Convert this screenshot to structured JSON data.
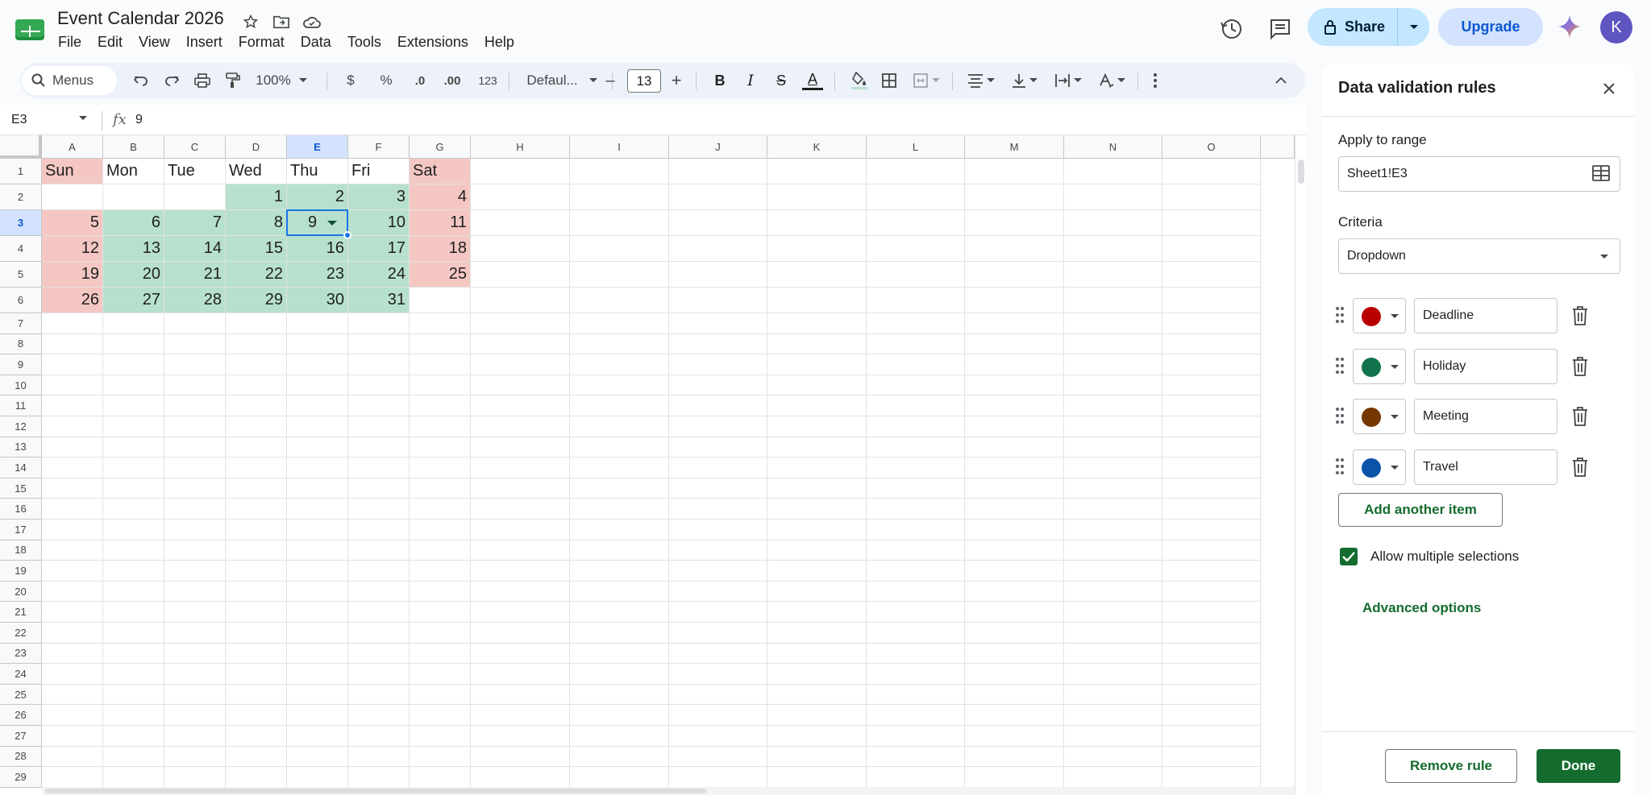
{
  "app": {
    "title": "Event Calendar 2026",
    "menu": [
      "File",
      "Edit",
      "View",
      "Insert",
      "Format",
      "Data",
      "Tools",
      "Extensions",
      "Help"
    ],
    "share_label": "Share",
    "upgrade_label": "Upgrade",
    "avatar_letter": "K"
  },
  "toolbar": {
    "menus_label": "Menus",
    "zoom": "100%",
    "currency": "$",
    "percent": "%",
    "dec_decrease": ".0",
    "dec_increase": ".00",
    "number_format": "123",
    "font": "Defaul...",
    "font_size": "13",
    "minus": "–",
    "plus": "+",
    "bold": "B",
    "italic": "I",
    "strike": "S",
    "text_color": "A"
  },
  "formula_bar": {
    "name_box": "E3",
    "fx": "fx",
    "value": "9"
  },
  "sheet": {
    "columns": [
      "A",
      "B",
      "C",
      "D",
      "E",
      "F",
      "G",
      "H",
      "I",
      "J",
      "K",
      "L",
      "M",
      "N",
      "O"
    ],
    "selected_column": "E",
    "selected_row": 3,
    "row_count": 29,
    "header_row": [
      "Sun",
      "Mon",
      "Tue",
      "Wed",
      "Thu",
      "Fri",
      "Sat"
    ],
    "weeks": [
      [
        "",
        "",
        "",
        "1",
        "2",
        "3",
        "4"
      ],
      [
        "5",
        "6",
        "7",
        "8",
        "9",
        "10",
        "11"
      ],
      [
        "12",
        "13",
        "14",
        "15",
        "16",
        "17",
        "18"
      ],
      [
        "19",
        "20",
        "21",
        "22",
        "23",
        "24",
        "25"
      ],
      [
        "26",
        "27",
        "28",
        "29",
        "30",
        "31",
        ""
      ]
    ],
    "colors": {
      "weekend": "#f4c7c3",
      "weekday": "#b7e1cd",
      "selection": "#1a73e8"
    }
  },
  "panel": {
    "title": "Data validation rules",
    "apply_label": "Apply to range",
    "range_value": "Sheet1!E3",
    "criteria_label": "Criteria",
    "criteria_value": "Dropdown",
    "items": [
      {
        "label": "Deadline",
        "color": "#b80000"
      },
      {
        "label": "Holiday",
        "color": "#11734b"
      },
      {
        "label": "Meeting",
        "color": "#753800"
      },
      {
        "label": "Travel",
        "color": "#0a53a8"
      }
    ],
    "add_item_label": "Add another item",
    "allow_multiple_label": "Allow multiple selections",
    "allow_multiple_checked": true,
    "advanced_label": "Advanced options",
    "remove_label": "Remove rule",
    "done_label": "Done"
  }
}
